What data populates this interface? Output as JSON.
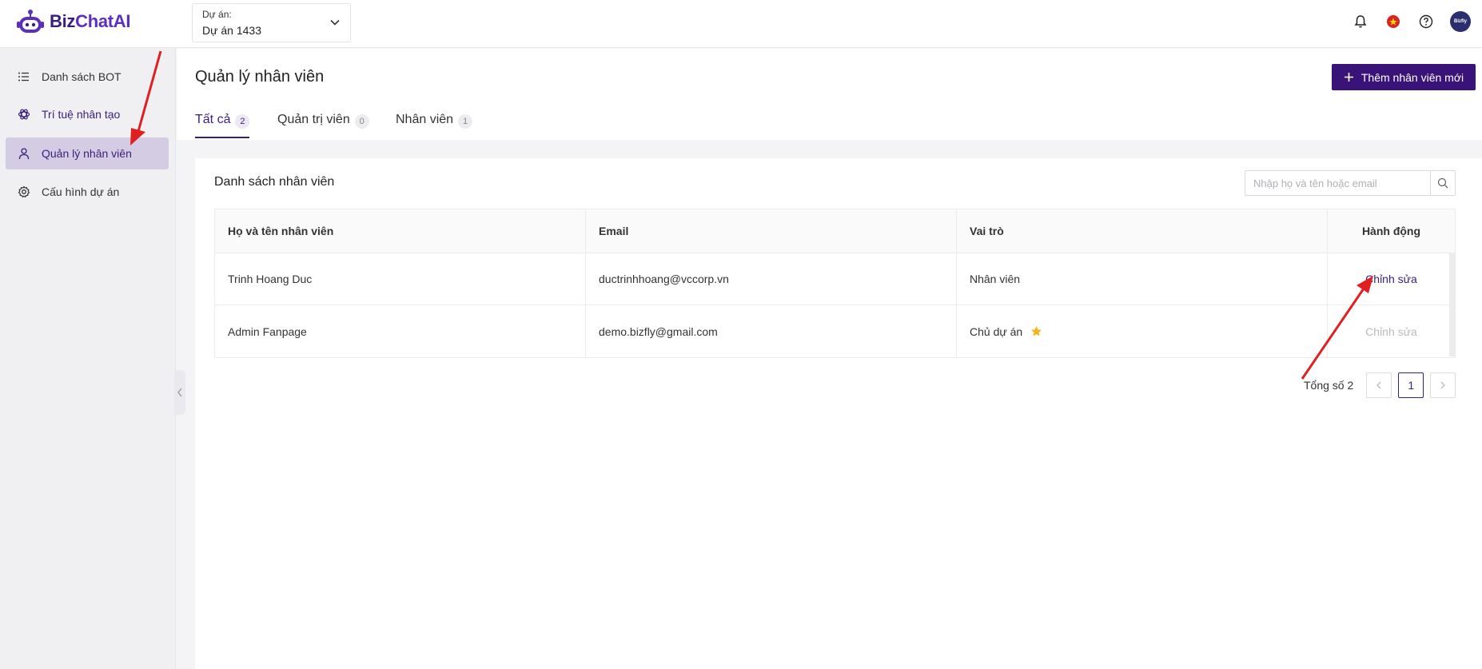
{
  "brand": {
    "name_part1": "Biz",
    "name_part2": "ChatAI",
    "color": "#3a1f7a"
  },
  "project_selector": {
    "label": "Dự án:",
    "value": "Dự án 1433"
  },
  "header_icons": [
    "bell-icon",
    "vietnam-flag-icon",
    "help-icon",
    "avatar"
  ],
  "avatar_text": "Bizfly",
  "sidebar": {
    "items": [
      {
        "label": "Danh sách BOT",
        "icon": "list-icon",
        "active": false
      },
      {
        "label": "Trí tuệ nhân tạo",
        "icon": "ai-icon",
        "active": false
      },
      {
        "label": "Quản lý nhân viên",
        "icon": "user-icon",
        "active": true
      },
      {
        "label": "Cấu hình dự án",
        "icon": "gear-icon",
        "active": false
      }
    ]
  },
  "page": {
    "title": "Quản lý nhân viên",
    "add_button": "Thêm nhân viên mới",
    "tabs": [
      {
        "label": "Tất cả",
        "count": "2"
      },
      {
        "label": "Quản trị viên",
        "count": "0"
      },
      {
        "label": "Nhân viên",
        "count": "1"
      }
    ]
  },
  "staff_list": {
    "title": "Danh sách nhân viên",
    "search_placeholder": "Nhập họ và tên hoặc email",
    "columns": [
      "Họ và tên nhân viên",
      "Email",
      "Vai trò",
      "Hành động"
    ],
    "rows": [
      {
        "name": "Trinh Hoang Duc",
        "email": "ductrinhhoang@vccorp.vn",
        "role": "Nhân viên",
        "action": "Chỉnh sửa",
        "action_enabled": true,
        "owner": false
      },
      {
        "name": "Admin Fanpage",
        "email": "demo.bizfly@gmail.com",
        "role": "Chủ dự án",
        "action": "Chỉnh sửa",
        "action_enabled": false,
        "owner": true
      }
    ]
  },
  "pagination": {
    "total_label": "Tổng số 2",
    "current_page": "1"
  },
  "colors": {
    "accent": "#3a1f7a",
    "button": "#3a1378",
    "star": "#f5b21a",
    "annotation_arrow": "#e02020"
  }
}
